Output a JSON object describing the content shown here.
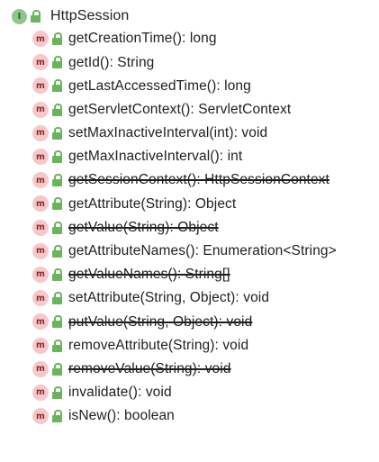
{
  "root": {
    "badge": "I",
    "label": "HttpSession",
    "badge_icon": "interface-icon",
    "access_icon": "public-lock-icon"
  },
  "method_badge": "m",
  "colors": {
    "interface_badge": "#8fc78a",
    "method_badge": "#f5c9c9",
    "lock": "#6bb35c",
    "text": "#1f1f1f"
  },
  "methods": [
    {
      "label": "getCreationTime(): long",
      "deprecated": false
    },
    {
      "label": "getId(): String",
      "deprecated": false
    },
    {
      "label": "getLastAccessedTime(): long",
      "deprecated": false
    },
    {
      "label": "getServletContext(): ServletContext",
      "deprecated": false
    },
    {
      "label": "setMaxInactiveInterval(int): void",
      "deprecated": false
    },
    {
      "label": "getMaxInactiveInterval(): int",
      "deprecated": false
    },
    {
      "label": "getSessionContext(): HttpSessionContext",
      "deprecated": true
    },
    {
      "label": "getAttribute(String): Object",
      "deprecated": false
    },
    {
      "label": "getValue(String): Object",
      "deprecated": true
    },
    {
      "label": "getAttributeNames(): Enumeration<String>",
      "deprecated": false
    },
    {
      "label": "getValueNames(): String[]",
      "deprecated": true
    },
    {
      "label": "setAttribute(String, Object): void",
      "deprecated": false
    },
    {
      "label": "putValue(String, Object): void",
      "deprecated": true
    },
    {
      "label": "removeAttribute(String): void",
      "deprecated": false
    },
    {
      "label": "removeValue(String): void",
      "deprecated": true
    },
    {
      "label": "invalidate(): void",
      "deprecated": false
    },
    {
      "label": "isNew(): boolean",
      "deprecated": false
    }
  ]
}
